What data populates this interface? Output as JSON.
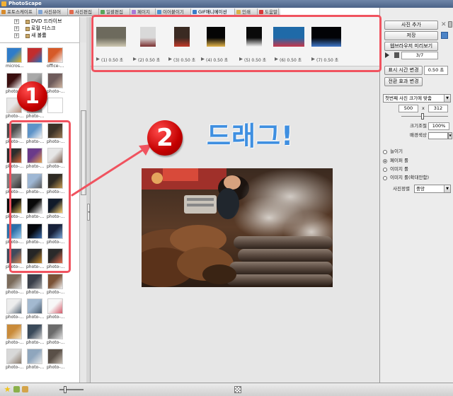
{
  "window": {
    "title": "PhotoScape"
  },
  "tabs": [
    {
      "label": "포토스케이프",
      "color": "#d78a2b"
    },
    {
      "label": "사진뷰어",
      "color": "#7fa4d4"
    },
    {
      "label": "사진편집",
      "color": "#e26a4e"
    },
    {
      "label": "일괄편집",
      "color": "#5aa55a"
    },
    {
      "label": "페이지",
      "color": "#a97ad6"
    },
    {
      "label": "이어붙이기",
      "color": "#4f93cf"
    },
    {
      "label": "GIF애니메이션",
      "color": "#3b7bc8"
    },
    {
      "label": "인쇄",
      "color": "#d9b24a"
    },
    {
      "label": "도움말",
      "color": "#d83a3a"
    }
  ],
  "tree": [
    {
      "label": "DVD 드라이브"
    },
    {
      "label": "로컬 디스크"
    },
    {
      "label": "새 볼륨"
    }
  ],
  "thumbnails": [
    {
      "label": "micros...",
      "c1": "#2f7cc9",
      "c2": "#e8b51a"
    },
    {
      "label": "",
      "c1": "#c22d2d",
      "c2": "#1d74c6"
    },
    {
      "label": "office-...",
      "c1": "#d65a28",
      "c2": "#f1f1f1"
    },
    {
      "label": "photo-...",
      "c1": "#3a0f0f",
      "c2": "#ffffff"
    },
    {
      "label": "photo-...",
      "c1": "#a8a8a8",
      "c2": "#666666"
    },
    {
      "label": "photo-...",
      "c1": "#6e5b5b",
      "c2": "#cfb6a2"
    },
    {
      "label": "photo-...",
      "c1": "#e8e8e8",
      "c2": "#b88f7a"
    },
    {
      "label": "photo-...",
      "c1": "#dcdcdc",
      "c2": "#8b8b8b"
    },
    {
      "label": "",
      "c1": "#ffffff",
      "c2": "#ffffff"
    },
    {
      "label": "photo-...",
      "c1": "#4a4a4a",
      "c2": "#bfbfbf"
    },
    {
      "label": "photo-...",
      "c1": "#5d93c8",
      "c2": "#f3f3f3"
    },
    {
      "label": "photo-...",
      "c1": "#3c3227",
      "c2": "#9c7b55"
    },
    {
      "label": "photo-...",
      "c1": "#2d2d2d",
      "c2": "#d66a3a"
    },
    {
      "label": "photo-...",
      "c1": "#6a3a8a",
      "c2": "#e7a24c"
    },
    {
      "label": "photo-...",
      "c1": "#e6e6e6",
      "c2": "#7a5c4a"
    },
    {
      "label": "photo-...",
      "c1": "#7d7d7d",
      "c2": "#2c2c2c"
    },
    {
      "label": "photo-...",
      "c1": "#9eb7d4",
      "c2": "#5a5a5a"
    },
    {
      "label": "photo-...",
      "c1": "#2e2a24",
      "c2": "#c49a52"
    },
    {
      "label": "photo-...",
      "c1": "#0c0c0c",
      "c2": "#d4b45a"
    },
    {
      "label": "photo-...",
      "c1": "#090909",
      "c2": "#f2f2f2"
    },
    {
      "label": "photo-...",
      "c1": "#101a2a",
      "c2": "#ffd36e"
    },
    {
      "label": "photo-...",
      "c1": "#2c6fa8",
      "c2": "#9fd0f0"
    },
    {
      "label": "photo-...",
      "c1": "#05070c",
      "c2": "#3d6fb0"
    },
    {
      "label": "photo-...",
      "c1": "#17213a",
      "c2": "#7aa6d8"
    },
    {
      "label": "photo-...",
      "c1": "#404a5c",
      "c2": "#d88a54"
    },
    {
      "label": "photo-...",
      "c1": "#262626",
      "c2": "#c98a2a"
    },
    {
      "label": "photo-...",
      "c1": "#2a2a2a",
      "c2": "#e56b4b"
    },
    {
      "label": "photo-...",
      "c1": "#7a6a5a",
      "c2": "#d9d9d9"
    },
    {
      "label": "photo-...",
      "c1": "#3a3f4a",
      "c2": "#ababab"
    },
    {
      "label": "photo-...",
      "c1": "#7b5236",
      "c2": "#f0f0f0"
    },
    {
      "label": "photo-...",
      "c1": "#ededed",
      "c2": "#5a6a7a"
    },
    {
      "label": "photo-...",
      "c1": "#a3b9d0",
      "c2": "#4b5d6f"
    },
    {
      "label": "photo-...",
      "c1": "#f7f7f7",
      "c2": "#d45a6a"
    },
    {
      "label": "photo-...",
      "c1": "#c98b3a",
      "c2": "#f2e1c2"
    },
    {
      "label": "photo-...",
      "c1": "#3a4a5a",
      "c2": "#cfcfcf"
    },
    {
      "label": "photo-...",
      "c1": "#6b6b6b",
      "c2": "#dfdfdf"
    },
    {
      "label": "photo-...",
      "c1": "#d8d8d8",
      "c2": "#8a7a6a"
    },
    {
      "label": "photo-...",
      "c1": "#8fa6bd",
      "c2": "#e9e9e9"
    },
    {
      "label": "photo-...",
      "c1": "#5a5048",
      "c2": "#c9c0b5"
    }
  ],
  "frames": [
    {
      "label": "(1) 0.50 초",
      "c1": "#6d6a5d",
      "c2": "#cfc9b3"
    },
    {
      "label": "(2) 0.50 초",
      "c1": "#d9d9d9",
      "c2": "#7a2f2f"
    },
    {
      "label": "(3) 0.50 초",
      "c1": "#3a2a22",
      "c2": "#c23a2a"
    },
    {
      "label": "(4) 0.50 초",
      "c1": "#050505",
      "c2": "#e2b44a"
    },
    {
      "label": "(5) 0.50 초",
      "c1": "#0a0a0a",
      "c2": "#f4f4f4"
    },
    {
      "label": "(6) 0.50 초",
      "c1": "#1f6aa8",
      "c2": "#c7364a"
    },
    {
      "label": "(7) 0.50 초",
      "c1": "#020306",
      "c2": "#3f77c8"
    }
  ],
  "right": {
    "add_photo": "사진 추가",
    "save": "저장",
    "preview": "웹브라우저 미리보기",
    "frame_count": "3/7",
    "display_time_btn": "표시 시간 변경",
    "display_time_val": "0.50 초",
    "transition_btn": "전환 효과 변경",
    "size_mode": "첫번째 사진 크기에 맞춤",
    "width": "500",
    "times": "x",
    "height": "312",
    "scale_label": "크기조절",
    "scale_value": "100%",
    "bg_label": "배경색상",
    "radios": [
      {
        "label": "늘이기",
        "selected": false
      },
      {
        "label": "페이퍼 롤",
        "selected": true
      },
      {
        "label": "이미지 롤",
        "selected": false
      },
      {
        "label": "이미지 롤(확대안함)",
        "selected": false
      }
    ],
    "align_label": "사진정렬",
    "align_value": "중앙"
  },
  "overlay": {
    "badge1": "1",
    "badge2": "2",
    "drag_text": "드래그!",
    "accent": "#f0535f",
    "text_color": "#3f8fe0"
  }
}
